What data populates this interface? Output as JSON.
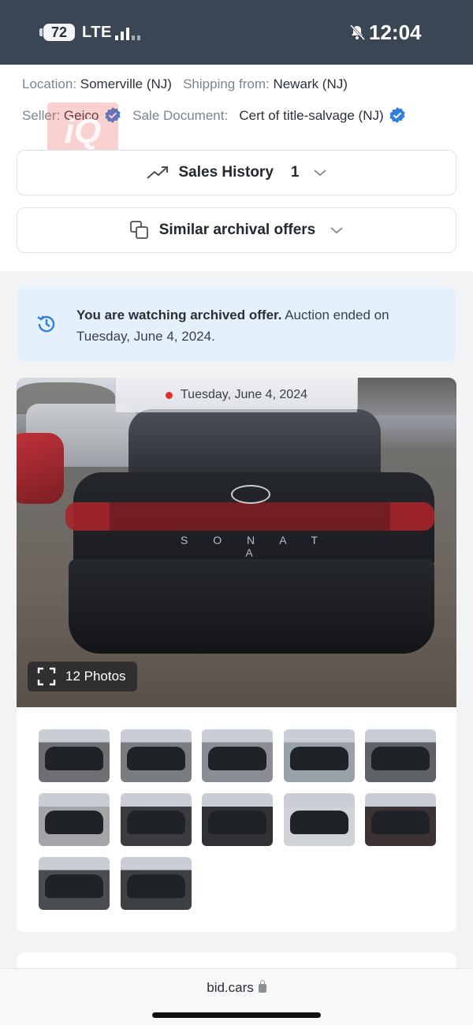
{
  "status_bar": {
    "battery": "72",
    "network": "LTE",
    "time": "12:04",
    "icons": [
      "signal-icon",
      "bell-muted-icon"
    ]
  },
  "listing": {
    "location_label": "Location:",
    "location_value": "Somerville (NJ)",
    "shipping_label": "Shipping from:",
    "shipping_value": "Newark (NJ)",
    "seller_label": "Seller:",
    "seller_value": "Geico",
    "sale_doc_label": "Sale Document:",
    "sale_doc_value": "Cert of title-salvage (NJ)",
    "watermark_text": "iQ"
  },
  "accordions": {
    "sales_history": {
      "label": "Sales History",
      "count": "1"
    },
    "similar_offers": {
      "label": "Similar archival offers"
    }
  },
  "notice": {
    "bold": "You are watching archived offer.",
    "rest": " Auction ended on Tuesday, June 4, 2024."
  },
  "gallery": {
    "date": "Tuesday, June 4, 2024",
    "photos_button": "12 Photos",
    "car_badge": "S O N A T A",
    "thumbnails": [
      {
        "tone": "#6d6f72"
      },
      {
        "tone": "#7a7d80"
      },
      {
        "tone": "#8a8e94"
      },
      {
        "tone": "#9aa0a7"
      },
      {
        "tone": "#5e6166"
      },
      {
        "tone": "#a3a5a8"
      },
      {
        "tone": "#3a3c40"
      },
      {
        "tone": "#2f3135"
      },
      {
        "tone": "#cfd2d6"
      },
      {
        "tone": "#3b3234"
      },
      {
        "tone": "#4a4d52"
      },
      {
        "tone": "#3c3f44"
      }
    ]
  },
  "browser": {
    "url": "bid.cars"
  },
  "colors": {
    "status_bar_bg": "#3b4654",
    "notice_bg": "#e4f1fb",
    "accent_blue": "#2f7fdc"
  }
}
